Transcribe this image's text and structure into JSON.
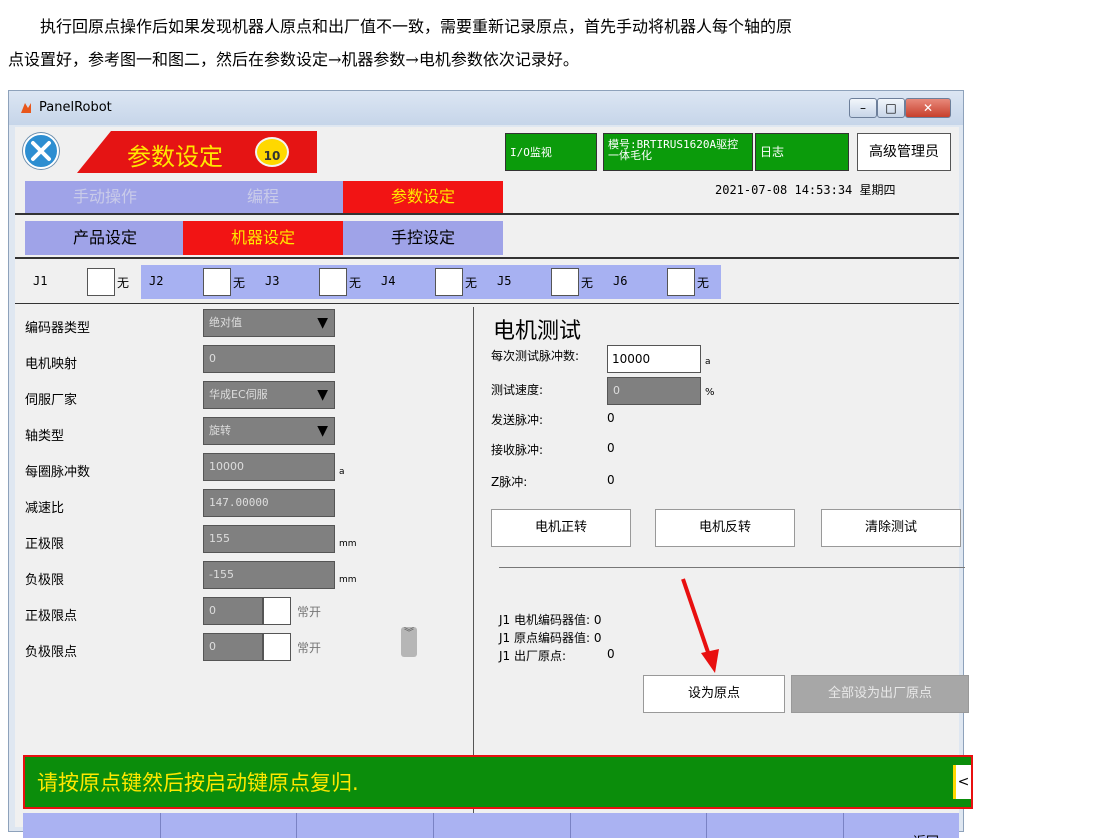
{
  "document": {
    "line1": "执行回原点操作后如果发现机器人原点和出厂值不一致，需要重新记录原点，首先手动将机器人每个轴的原",
    "line2": "点设置好，参考图一和图二，然后在参数设定→机器参数→电机参数依次记录好。"
  },
  "window": {
    "title": "PanelRobot",
    "buttons": {
      "minimize": "–",
      "maximize": "□",
      "close": "✕"
    }
  },
  "header": {
    "mode_title": "参数设定",
    "speed_value": "10",
    "io_label": "I/O监视",
    "model_label": "模号:BRTIRUS1620A驱控一体毛化",
    "log_label": "日志",
    "user_label": "高级管理员",
    "datetime": "2021-07-08  14:53:34  星期四"
  },
  "main_tabs": [
    {
      "label": "手动操作"
    },
    {
      "label": "编程"
    },
    {
      "label": "参数设定"
    }
  ],
  "sub_tabs": [
    {
      "label": "产品设定"
    },
    {
      "label": "机器设定"
    },
    {
      "label": "手控设定"
    }
  ],
  "axes": [
    {
      "label": "J1",
      "none": "无"
    },
    {
      "label": "J2",
      "none": "无"
    },
    {
      "label": "J3",
      "none": "无"
    },
    {
      "label": "J4",
      "none": "无"
    },
    {
      "label": "J5",
      "none": "无"
    },
    {
      "label": "J6",
      "none": "无"
    }
  ],
  "params": {
    "encoder_type": {
      "label": "编码器类型",
      "value": "绝对值"
    },
    "motor_map": {
      "label": "电机映射",
      "value": "0"
    },
    "servo_vendor": {
      "label": "伺服厂家",
      "value": "华成EC伺服"
    },
    "axis_type": {
      "label": "轴类型",
      "value": "旋转"
    },
    "pulses_per_rev": {
      "label": "每圈脉冲数",
      "value": "10000",
      "unit": "a"
    },
    "gear_ratio": {
      "label": "减速比",
      "value": "147.00000"
    },
    "pos_limit": {
      "label": "正极限",
      "value": "155",
      "unit": "mm"
    },
    "neg_limit": {
      "label": "负极限",
      "value": "-155",
      "unit": "mm"
    },
    "pos_limit_point": {
      "label": "正极限点",
      "value": "0",
      "state": "常开"
    },
    "neg_limit_point": {
      "label": "负极限点",
      "value": "0",
      "state": "常开"
    },
    "scroll_glyph": "︾"
  },
  "motor_test": {
    "title": "电机测试",
    "pulses_label": "每次测试脉冲数:",
    "pulses_value": "10000",
    "pulses_unit": "a",
    "speed_label": "测试速度:",
    "speed_value": "0",
    "speed_unit": "%",
    "sent_label": "发送脉冲:",
    "sent_value": "0",
    "recv_label": "接收脉冲:",
    "recv_value": "0",
    "z_label": "Z脉冲:",
    "z_value": "0",
    "forward_btn": "电机正转",
    "reverse_btn": "电机反转",
    "clear_btn": "清除测试",
    "encoder_motor": "J1 电机编码器值: 0",
    "encoder_origin": "J1 原点编码器值: 0",
    "factory_origin_label": "J1 出厂原点:",
    "factory_origin_value": "0",
    "set_origin_btn": "设为原点",
    "set_all_factory_btn": "全部设为出厂原点"
  },
  "status": {
    "message": "请按原点键然后按启动键原点复归.",
    "scroll_glyph": "<"
  },
  "bottom": {
    "back_label": "返回"
  },
  "colors": {
    "active_red": "#f21414",
    "active_text": "#ffe800",
    "tab_purple": "#9fa3e8",
    "status_green": "#0b8d0b",
    "arrow_red": "#e81010"
  }
}
